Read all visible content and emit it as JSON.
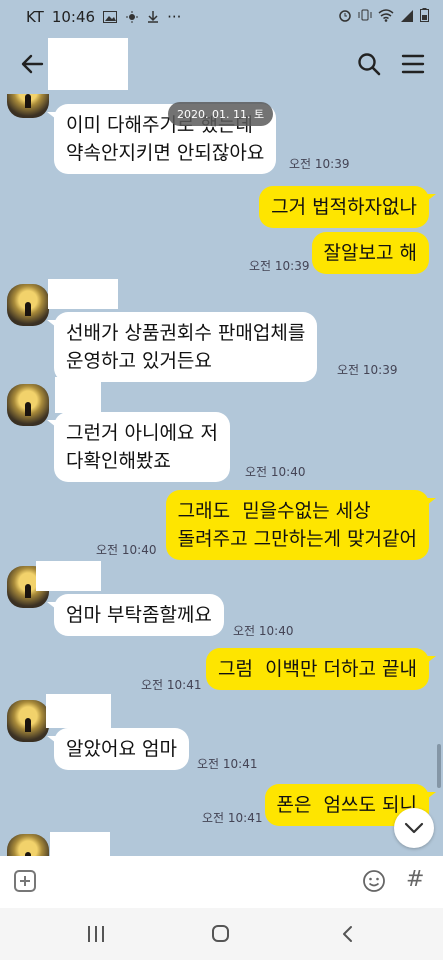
{
  "status": {
    "carrier": "KT",
    "time": "10:46",
    "more": "···"
  },
  "header": {
    "back_icon": "arrow-left-icon",
    "search_icon": "search-icon",
    "menu_icon": "hamburger-menu-icon"
  },
  "date_divider": "2020. 01. 11. 토",
  "messages": [
    {
      "from": "them",
      "text": "이미 다해주기로 했는데\n약속안지키면 안되잖아요",
      "time": "오전 10:39"
    },
    {
      "from": "me",
      "text": "그거 법적하자없나",
      "time": ""
    },
    {
      "from": "me",
      "text": "잘알보고 해",
      "time": "오전 10:39"
    },
    {
      "from": "them",
      "text": "선배가 상품권회수 판매업체를\n운영하고 있거든요",
      "time": "오전 10:39"
    },
    {
      "from": "them",
      "text": "그런거 아니에요 저\n다확인해봤죠",
      "time": "오전 10:40"
    },
    {
      "from": "me",
      "text": "그래도  믿을수없는 세상\n돌려주고 그만하는게 맞거같어",
      "time": "오전 10:40"
    },
    {
      "from": "them",
      "text": "엄마 부탁좀할께요",
      "time": "오전 10:40"
    },
    {
      "from": "me",
      "text": "그럼  이백만 더하고 끝내",
      "time": "오전 10:41"
    },
    {
      "from": "them",
      "text": "알았어요 엄마",
      "time": "오전 10:41"
    },
    {
      "from": "me",
      "text": "폰은  엄쓰도 되니",
      "time": "오전 10:41"
    }
  ],
  "input": {
    "plus_icon": "plus-box-icon",
    "emoji_icon": "emoji-icon",
    "hash_label": "#"
  },
  "colors": {
    "background": "#b2c7d9",
    "my_bubble": "#fee500",
    "their_bubble": "#ffffff"
  }
}
